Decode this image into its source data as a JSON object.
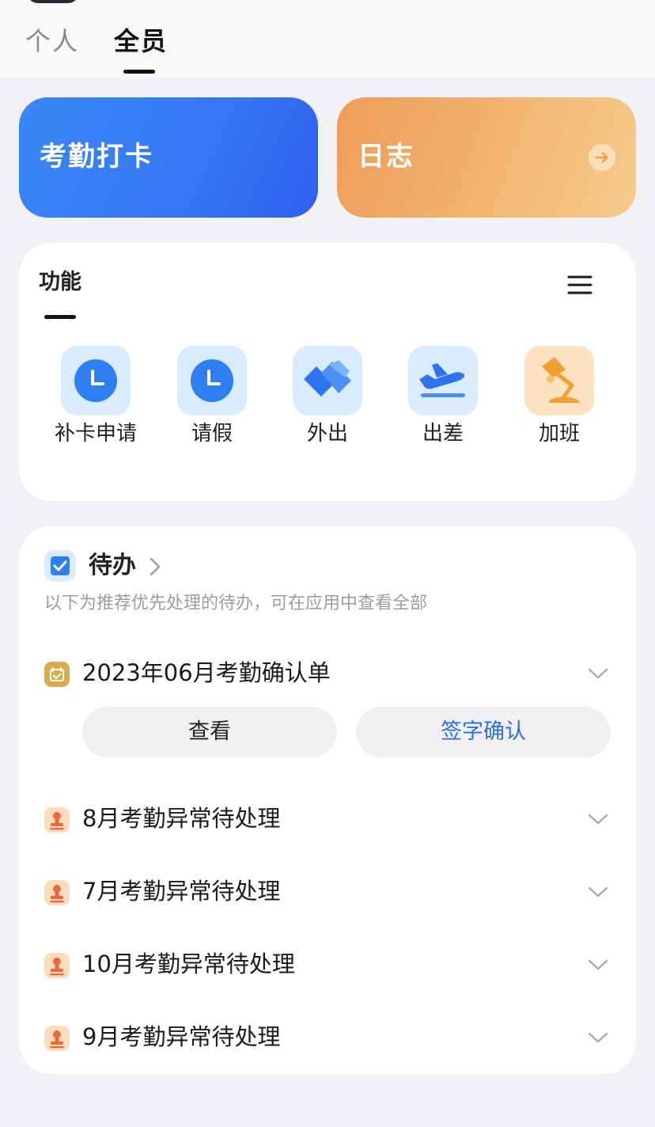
{
  "header": {
    "tabs": [
      {
        "label": "个人",
        "active": false
      },
      {
        "label": "全员",
        "active": true
      }
    ]
  },
  "hero": {
    "attendance_label": "考勤打卡",
    "log_label": "日志"
  },
  "functions": {
    "title": "功能",
    "items": [
      {
        "label": "补卡申请",
        "icon": "clock-icon"
      },
      {
        "label": "请假",
        "icon": "clock-icon"
      },
      {
        "label": "外出",
        "icon": "handshake-icon"
      },
      {
        "label": "出差",
        "icon": "plane-icon"
      },
      {
        "label": "加班",
        "icon": "desk-lamp-icon"
      }
    ]
  },
  "todo": {
    "title": "待办",
    "subtitle": "以下为推荐优先处理的待办，可在应用中查看全部",
    "items": [
      {
        "label": "2023年06月考勤确认单",
        "icon": "calendar-icon",
        "actions": [
          "查看",
          "签字确认"
        ]
      },
      {
        "label": "8月考勤异常待处理",
        "icon": "stamp-icon"
      },
      {
        "label": "7月考勤异常待处理",
        "icon": "stamp-icon"
      },
      {
        "label": "10月考勤异常待处理",
        "icon": "stamp-icon"
      },
      {
        "label": "9月考勤异常待处理",
        "icon": "stamp-icon"
      }
    ]
  },
  "colors": {
    "primary_blue": "#3676f3",
    "log_orange": "#f2b672",
    "link_blue": "#2e6fd8",
    "page_background": "#f1f1f6"
  }
}
